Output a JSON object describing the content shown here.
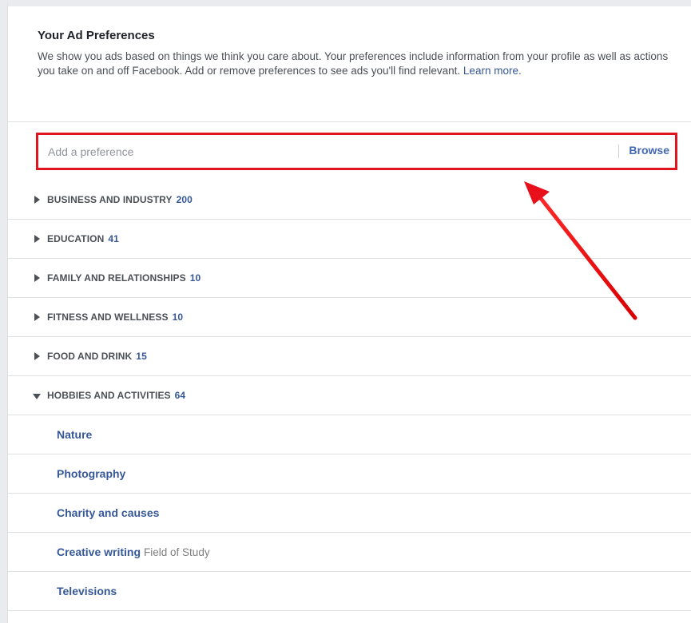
{
  "header": {
    "title": "Your Ad Preferences",
    "description": "We show you ads based on things we think you care about. Your preferences include information from your profile as well as actions you take on and off Facebook. Add or remove preferences to see ads you'll find relevant.",
    "learn_more": "Learn more."
  },
  "search": {
    "placeholder": "Add a preference",
    "browse_label": "Browse"
  },
  "categories": [
    {
      "label": "BUSINESS AND INDUSTRY",
      "count": "200"
    },
    {
      "label": "EDUCATION",
      "count": "41"
    },
    {
      "label": "FAMILY AND RELATIONSHIPS",
      "count": "10"
    },
    {
      "label": "FITNESS AND WELLNESS",
      "count": "10"
    },
    {
      "label": "FOOD AND DRINK",
      "count": "15"
    },
    {
      "label": "HOBBIES AND ACTIVITIES",
      "count": "64"
    }
  ],
  "hobbies_items": [
    {
      "name": "Nature",
      "sub": ""
    },
    {
      "name": "Photography",
      "sub": ""
    },
    {
      "name": "Charity and causes",
      "sub": ""
    },
    {
      "name": "Creative writing",
      "sub": "Field of Study"
    },
    {
      "name": "Televisions",
      "sub": ""
    }
  ],
  "colors": {
    "highlight_box": "#e0151f",
    "link": "#365899",
    "browse": "#4267b2"
  }
}
